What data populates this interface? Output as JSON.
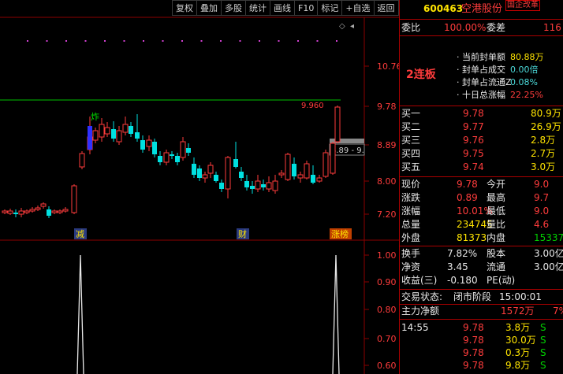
{
  "toolbar": {
    "buttons": [
      "复权",
      "叠加",
      "多股",
      "统计",
      "画线",
      "F10",
      "标记",
      "+自选",
      "返回"
    ]
  },
  "chart": {
    "price_ticks": [
      "10.76",
      "9.78",
      "8.89",
      "8.00",
      "7.20"
    ],
    "indicator_ticks": [
      "1.00",
      "0.90",
      "0.80",
      "0.70",
      "0.60"
    ],
    "limit_price_label": "9.960",
    "range_label": "8.89 - 9.",
    "candle_annotation": "炸",
    "events": [
      "减",
      "财",
      "涨榜"
    ],
    "colors": {
      "up": "#ff3c3c",
      "down": "#00e0e0",
      "grid": "#8b0000",
      "limit_line": "#00c000",
      "dots": "#d040d0"
    }
  },
  "quote": {
    "code": "600463",
    "name": "空港股份",
    "tag": "国企改革",
    "weibi_label": "委比",
    "weibi_value": "100.00%",
    "weicha_label": "委差",
    "weicha_value": "116",
    "streak": "2连板",
    "seal_info": [
      {
        "label": "当前封单额",
        "value": "80.88万"
      },
      {
        "label": "封单占成交",
        "value": "0.00倍"
      },
      {
        "label": "封单占流通Z",
        "value": "0.08%"
      },
      {
        "label": "十日总涨幅",
        "value": "22.25%"
      }
    ],
    "sell_orders": [
      {
        "label": "买一",
        "price": "9.78",
        "volume": "80.9万"
      },
      {
        "label": "买二",
        "price": "9.77",
        "volume": "26.9万"
      },
      {
        "label": "买三",
        "price": "9.76",
        "volume": "2.8万"
      },
      {
        "label": "买四",
        "price": "9.75",
        "volume": "2.7万"
      },
      {
        "label": "买五",
        "price": "9.74",
        "volume": "3.0万"
      }
    ],
    "stats": [
      {
        "l1": "现价",
        "v1": "9.78",
        "l2": "今开",
        "v2": "9.0"
      },
      {
        "l1": "涨跌",
        "v1": "0.89",
        "l2": "最高",
        "v2": "9.7"
      },
      {
        "l1": "涨幅",
        "v1": "10.01%",
        "l2": "最低",
        "v2": "9.0"
      },
      {
        "l1": "总量",
        "v1": "234745",
        "l2": "量比",
        "v2": "4.6"
      },
      {
        "l1": "外盘",
        "v1": "81373",
        "l2": "内盘",
        "v2": "15337"
      }
    ],
    "stats2": [
      {
        "l1": "换手",
        "v1": "7.82%",
        "l2": "股本",
        "v2": "3.00亿"
      },
      {
        "l1": "净资",
        "v1": "3.45",
        "l2": "流通",
        "v2": "3.00亿"
      },
      {
        "l1": "收益(三)",
        "v1": "-0.180",
        "l2": "PE(动)",
        "v2": ""
      }
    ],
    "trade_status_label": "交易状态:",
    "trade_status": "闭市阶段",
    "trade_time": "15:00:01",
    "net_flow_label": "主力净额",
    "net_flow_value": "1572万",
    "net_flow_pct": "7%",
    "ticks": [
      {
        "time": "14:55",
        "price": "9.78",
        "vol": "3.8万",
        "side": "S"
      },
      {
        "time": "",
        "price": "9.78",
        "vol": "30.0万",
        "side": "S"
      },
      {
        "time": "",
        "price": "9.78",
        "vol": "0.3万",
        "side": "S"
      },
      {
        "time": "",
        "price": "9.78",
        "vol": "9.8万",
        "side": "S"
      }
    ]
  }
}
